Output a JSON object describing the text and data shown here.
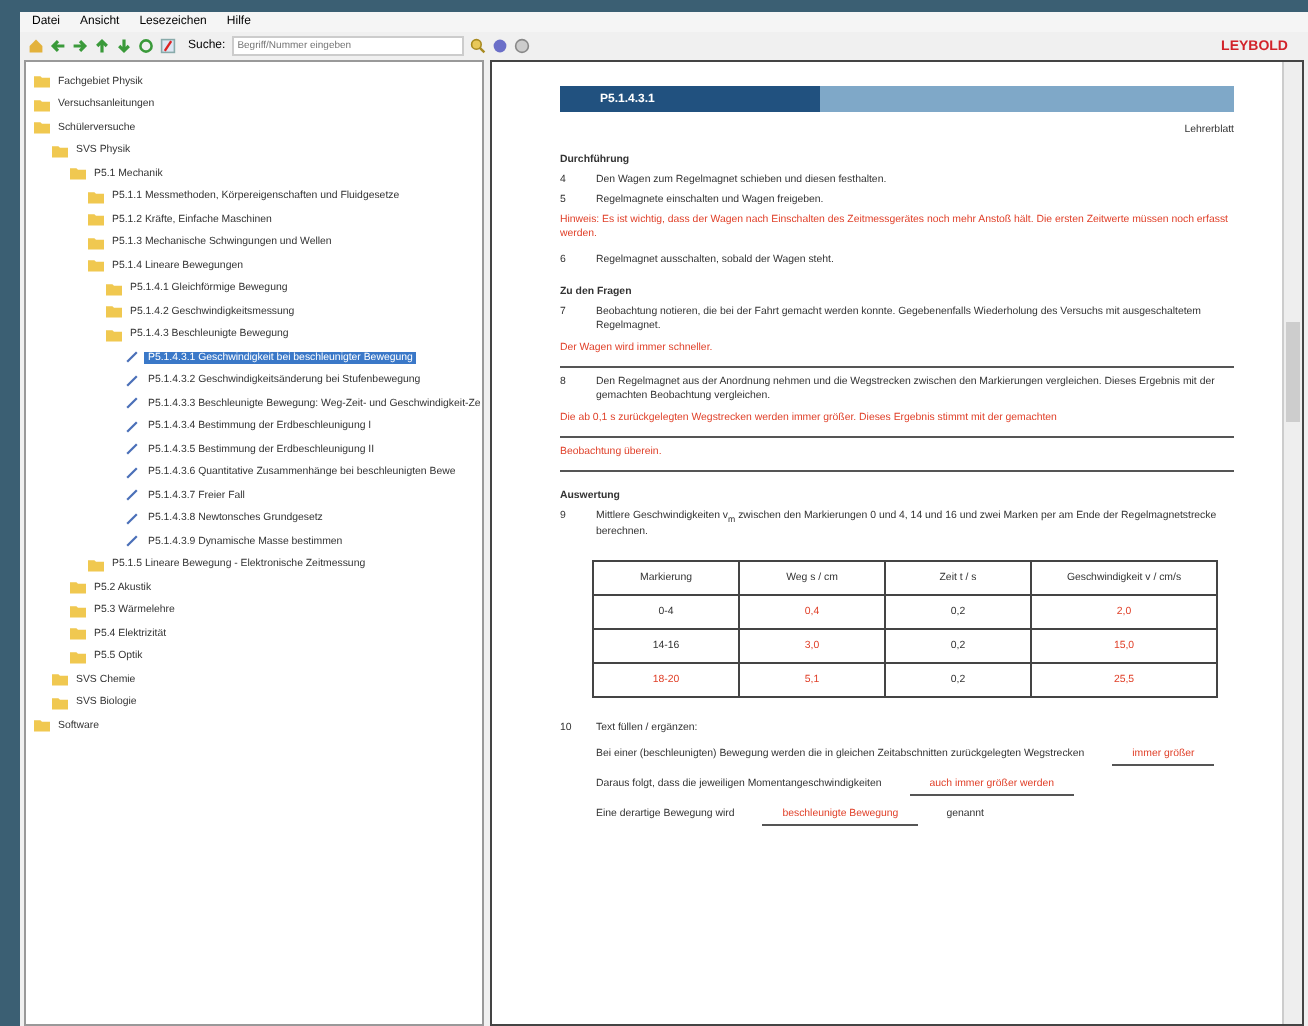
{
  "menu": [
    "Datei",
    "Ansicht",
    "Lesezeichen",
    "Hilfe"
  ],
  "search": {
    "label": "Suche:",
    "placeholder": "Begriff/Nummer eingeben"
  },
  "logo": "LEYBOLD",
  "tree": [
    {
      "label": "Fachgebiet Physik",
      "kind": "folder",
      "selected": false
    },
    {
      "label": "Versuchsanleitungen",
      "kind": "folder",
      "selected": false
    },
    {
      "label": "Schülerversuche",
      "kind": "folder",
      "selected": false,
      "children": [
        {
          "label": "SVS Physik",
          "kind": "folder",
          "selected": false,
          "children": [
            {
              "label": "P5.1 Mechanik",
              "kind": "folder",
              "selected": false,
              "children": [
                {
                  "label": "P5.1.1 Messmethoden, Körpereigenschaften und Fluidgesetze",
                  "kind": "folder",
                  "selected": false
                },
                {
                  "label": "P5.1.2 Kräfte, Einfache Maschinen",
                  "kind": "folder",
                  "selected": false
                },
                {
                  "label": "P5.1.3 Mechanische Schwingungen und Wellen",
                  "kind": "folder",
                  "selected": false
                },
                {
                  "label": "P5.1.4 Lineare Bewegungen",
                  "kind": "folder",
                  "selected": false,
                  "children": [
                    {
                      "label": "P5.1.4.1 Gleichförmige Bewegung",
                      "kind": "folder",
                      "selected": false
                    },
                    {
                      "label": "P5.1.4.2 Geschwindigkeitsmessung",
                      "kind": "folder",
                      "selected": false
                    },
                    {
                      "label": "P5.1.4.3 Beschleunigte Bewegung",
                      "kind": "folder",
                      "selected": false,
                      "children": [
                        {
                          "label": "P5.1.4.3.1 Geschwindigkeit bei beschleunigter Bewegung",
                          "kind": "page",
                          "selected": true
                        },
                        {
                          "label": "P5.1.4.3.2 Geschwindigkeitsänderung bei Stufenbewegung",
                          "kind": "page",
                          "selected": false
                        },
                        {
                          "label": "P5.1.4.3.3 Beschleunigte Bewegung: Weg-Zeit- und Geschwindigkeit-Ze",
                          "kind": "page",
                          "selected": false
                        },
                        {
                          "label": "P5.1.4.3.4 Bestimmung der Erdbeschleunigung I",
                          "kind": "page",
                          "selected": false
                        },
                        {
                          "label": "P5.1.4.3.5 Bestimmung der Erdbeschleunigung II",
                          "kind": "page",
                          "selected": false
                        },
                        {
                          "label": "P5.1.4.3.6 Quantitative Zusammenhänge bei beschleunigten Bewe",
                          "kind": "page",
                          "selected": false
                        },
                        {
                          "label": "P5.1.4.3.7 Freier Fall",
                          "kind": "page",
                          "selected": false
                        },
                        {
                          "label": "P5.1.4.3.8 Newtonsches Grundgesetz",
                          "kind": "page",
                          "selected": false
                        },
                        {
                          "label": "P5.1.4.3.9 Dynamische Masse bestimmen",
                          "kind": "page",
                          "selected": false
                        }
                      ]
                    }
                  ]
                },
                {
                  "label": "P5.1.5 Lineare Bewegung - Elektronische Zeitmessung",
                  "kind": "folder",
                  "selected": false
                }
              ]
            },
            {
              "label": "P5.2 Akustik",
              "kind": "folder",
              "selected": false
            },
            {
              "label": "P5.3 Wärmelehre",
              "kind": "folder",
              "selected": false
            },
            {
              "label": "P5.4 Elektrizität",
              "kind": "folder",
              "selected": false
            },
            {
              "label": "P5.5 Optik",
              "kind": "folder",
              "selected": false
            }
          ]
        },
        {
          "label": "SVS Chemie",
          "kind": "folder",
          "selected": false
        },
        {
          "label": "SVS Biologie",
          "kind": "folder",
          "selected": false
        }
      ]
    },
    {
      "label": "Software",
      "kind": "folder",
      "selected": false
    }
  ],
  "document": {
    "code": "P5.1.4.3.1",
    "role": "Lehrerblatt",
    "blocks": [
      {
        "kind": "heading",
        "text": "Durchführung"
      },
      {
        "kind": "step",
        "number": "4",
        "text": "Den Wagen zum Regelmagnet schieben und diesen festhalten."
      },
      {
        "kind": "step",
        "number": "5",
        "text": "Regelmagnete einschalten und Wagen freigeben."
      },
      {
        "kind": "note",
        "text": "Hinweis: Es ist wichtig, dass der Wagen nach Einschalten des Zeitmessgerätes noch mehr Anstoß hält. Die ersten Zeitwerte müssen noch erfasst werden."
      },
      {
        "kind": "step",
        "number": "6",
        "text": "Regelmagnet ausschalten, sobald der Wagen steht."
      },
      {
        "kind": "heading",
        "text": "Zu den Fragen"
      },
      {
        "kind": "step",
        "number": "7",
        "text": "Beobachtung notieren, die bei der Fahrt gemacht werden konnte. Gegebenenfalls Wiederholung des Versuchs mit ausgeschaltetem Regelmagnet."
      },
      {
        "kind": "answer",
        "text": "Der Wagen wird immer schneller."
      },
      {
        "kind": "step",
        "number": "8",
        "text": "Den Regelmagnet aus der Anordnung nehmen und die Wegstrecken zwischen den Markierungen vergleichen. Dieses Ergebnis mit der gemachten Beobachtung vergleichen."
      },
      {
        "kind": "answer",
        "text": "Die ab 0,1 s zurückgelegten Wegstrecken werden immer größer. Dieses Ergebnis stimmt mit der gemachten"
      },
      {
        "kind": "answer",
        "text": "Beobachtung überein."
      },
      {
        "kind": "heading",
        "text": "Auswertung"
      },
      {
        "kind": "step",
        "number": "9",
        "text": "Mittlere Geschwindigkeiten v$_{m}$ zwischen den Markierungen 0 und 4, 14 und 16 und zwei Marken per am Ende der Regelmagnetstrecke berechnen."
      },
      {
        "kind": "table",
        "columns": [
          "Markierung",
          "Weg s / cm",
          "Zeit t / s",
          "Geschwindigkeit v / cm/s"
        ],
        "rows": [
          [
            {
              "text": "0-4",
              "answer": false
            },
            {
              "text": "0,4",
              "answer": true
            },
            {
              "text": "0,2",
              "answer": false
            },
            {
              "text": "2,0",
              "answer": true
            }
          ],
          [
            {
              "text": "14-16",
              "answer": false
            },
            {
              "text": "3,0",
              "answer": true
            },
            {
              "text": "0,2",
              "answer": false
            },
            {
              "text": "15,0",
              "answer": true
            }
          ],
          [
            {
              "text": "18-20",
              "answer": true
            },
            {
              "text": "5,1",
              "answer": true
            },
            {
              "text": "0,2",
              "answer": false
            },
            {
              "text": "25,5",
              "answer": true
            }
          ]
        ]
      },
      {
        "kind": "step",
        "number": "10",
        "text": "Text füllen / ergänzen:"
      },
      {
        "kind": "fill",
        "parts": [
          {
            "text": "Bei einer (beschleunigten) Bewegung werden die in gleichen Zeitabschnitten zurückgelegten Wegstrecken",
            "answer": false
          },
          {
            "text": "immer größer",
            "answer": true
          }
        ]
      },
      {
        "kind": "fill",
        "parts": [
          {
            "text": "Daraus folgt, dass die jeweiligen Momentangeschwindigkeiten",
            "answer": false
          },
          {
            "text": "auch immer größer werden",
            "answer": true
          }
        ]
      },
      {
        "kind": "fill",
        "parts": [
          {
            "text": "Eine derartige Bewegung wird",
            "answer": false
          },
          {
            "text": "beschleunigte Bewegung",
            "answer": true
          },
          {
            "text": "genannt",
            "answer": false
          }
        ]
      }
    ]
  }
}
